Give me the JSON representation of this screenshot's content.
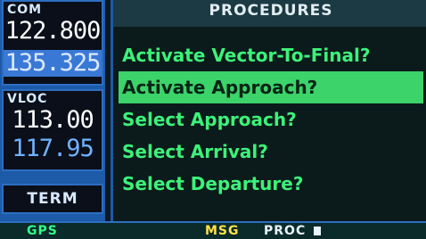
{
  "radio": {
    "com": {
      "label": "COM",
      "active": "122.800",
      "standby": "135.325"
    },
    "vloc": {
      "label": "VLOC",
      "active": "113.00",
      "standby": "117.95"
    },
    "cdi_mode": "TERM"
  },
  "procedures": {
    "title": "PROCEDURES",
    "items": [
      {
        "label": "Activate Vector-To-Final?"
      },
      {
        "label": "Activate Approach?"
      },
      {
        "label": "Select Approach?"
      },
      {
        "label": "Select Arrival?"
      },
      {
        "label": "Select Departure?"
      }
    ],
    "selected_index": 1
  },
  "status_bar": {
    "mode": "GPS",
    "msg": "MSG",
    "page": "PROC"
  },
  "colors": {
    "accent_blue": "#1d5aa8",
    "menu_green": "#3cf27a",
    "msg_yellow": "#ffe14a"
  }
}
